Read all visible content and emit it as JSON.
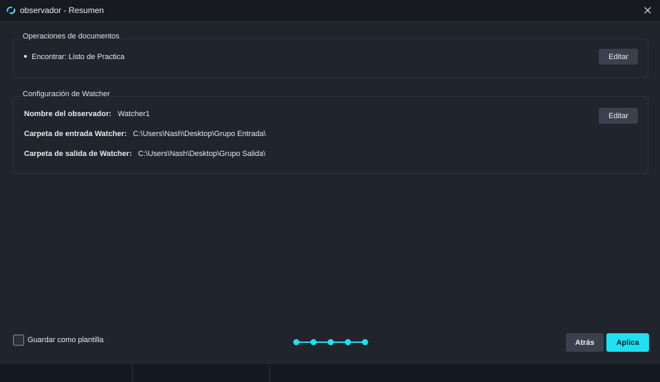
{
  "window": {
    "title": "observador - Resumen",
    "icon": "observer-sync-icon",
    "accent": "#1ee0f2"
  },
  "document_operations": {
    "title": "Operaciones de documentos",
    "items": [
      "Encontrar: Listo de Practica"
    ],
    "edit_label": "Editar"
  },
  "watcher_config": {
    "title": "Configuración de Watcher",
    "edit_label": "Editar",
    "fields": [
      {
        "label": "Nombre del observador:",
        "value": "Watcher1"
      },
      {
        "label": "Carpeta de entrada Watcher:",
        "value": "C:\\Users\\Nash\\Desktop\\Grupo Entrada\\"
      },
      {
        "label": "Carpeta de salida de Watcher:",
        "value": "C:\\Users\\Nash\\Desktop\\Grupo Salida\\"
      }
    ]
  },
  "footer": {
    "save_template_label": "Guardar como plantilla",
    "save_template_checked": false,
    "steps_total": 5,
    "steps_completed": 5,
    "back_label": "Atrás",
    "apply_label": "Aplica"
  }
}
